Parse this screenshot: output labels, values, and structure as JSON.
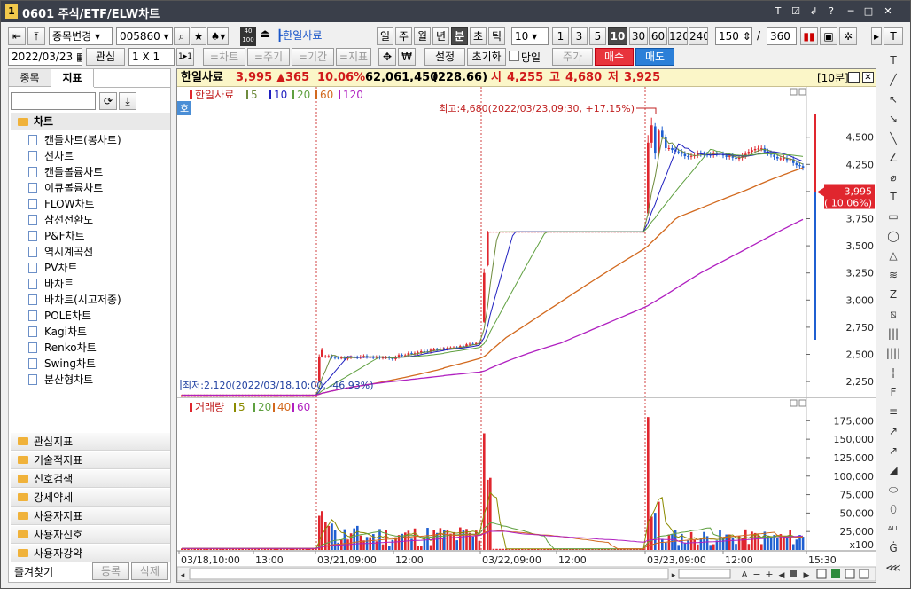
{
  "window": {
    "number": "1",
    "title": "0601 주식/ETF/ELW차트",
    "controls": [
      "T",
      "☑",
      "↲",
      "?",
      "─",
      "□",
      "✕"
    ]
  },
  "toolbar": {
    "stock_change": "종목변경",
    "stock_code": "005860",
    "stock_name": "한일사료",
    "minute_box": "40\n100",
    "periods": [
      "일",
      "주",
      "월",
      "년",
      "분",
      "초",
      "틱"
    ],
    "active_period": "분",
    "interval_value": "10",
    "intervals": [
      "1",
      "3",
      "5",
      "10",
      "30",
      "60",
      "120",
      "240"
    ],
    "active_interval": "10",
    "count_view": "150",
    "count_sep": "/",
    "count_total": "360",
    "date": "2022/03/23",
    "interest": "관심",
    "layout": "1 X 1",
    "one_by_one": "1▸1",
    "chart_btns": [
      "=차트",
      "=주기",
      "=기간",
      "=지표"
    ],
    "settings": "설정",
    "reset": "초기화",
    "sameday_label": "당일",
    "price_btn": "주가",
    "buy_btn": "매수",
    "sell_btn": "매도"
  },
  "left_panel": {
    "tabs": [
      "종목",
      "지표"
    ],
    "active_tab": "지표",
    "section_title": "차트",
    "items": [
      "캔들차트(봉차트)",
      "선차트",
      "캔들볼륨차트",
      "이큐볼륨차트",
      "FLOW차트",
      "삼선전환도",
      "P&F차트",
      "역시계곡선",
      "PV차트",
      "바차트",
      "바차트(시고저종)",
      "POLE차트",
      "Kagi차트",
      "Renko차트",
      "Swing차트",
      "분산형차트"
    ],
    "categories": [
      "관심지표",
      "기술적지표",
      "신호검색",
      "강세약세",
      "사용자지표",
      "사용자신호",
      "사용자강약"
    ],
    "favorites": "즐겨찾기",
    "register": "등록",
    "delete": "삭제"
  },
  "info_bar": {
    "name": "한일사료",
    "price": "3,995",
    "change": "▲365",
    "change_pct": "10.06%",
    "volume": "62,061,450",
    "volume_ratio": "(228.66)",
    "open_label": "시",
    "open": "4,255",
    "high_label": "고",
    "high": "4,680",
    "low_label": "저",
    "low": "3,925",
    "period_label": "[10분]"
  },
  "price_panel": {
    "legend_name": "한일사료",
    "ma_legend": [
      "5",
      "10",
      "20",
      "60",
      "120"
    ],
    "ma_colors": [
      "#6e8b3d",
      "#1f1fbf",
      "#5fa040",
      "#d2691e",
      "#b020c0"
    ],
    "hoga": "호",
    "high_annotation": "최고:4,680(2022/03/23,09:30, +17.15%)",
    "low_annotation": "최저:2,120(2022/03/18,10:00, -46.93%)",
    "current_price": "3,995",
    "current_pct": "( 10.06%)"
  },
  "volume_panel": {
    "legend_name": "거래량",
    "ma_legend": [
      "5",
      "20",
      "40",
      "60"
    ],
    "ma_colors": [
      "#8b8b00",
      "#5fa040",
      "#d2691e",
      "#b020c0"
    ],
    "unit": "x100"
  },
  "x_axis_labels": [
    "03/18,10:00",
    "13:00",
    "03/21,09:00",
    "12:00",
    "03/22,09:00",
    "12:00",
    "03/23,09:00",
    "12:00",
    "15:30"
  ],
  "chart_data": [
    {
      "type": "candlestick",
      "title": "한일사료",
      "ylim": [
        2120,
        4800
      ],
      "y_ticks": [
        "4,500",
        "4,250",
        "4,000",
        "3,750",
        "3,500",
        "3,250",
        "3,000",
        "2,750",
        "2,500",
        "2,250"
      ],
      "y_tick_values": [
        4500,
        4250,
        4000,
        3750,
        3500,
        3250,
        3000,
        2750,
        2500,
        2250
      ],
      "series": [
        {
          "name": "한일사료",
          "segments": [
            {
              "day": "03/18",
              "open": 2120,
              "close": 2130,
              "high": 2140,
              "low": 2120
            },
            {
              "day": "03/21",
              "open": 2480,
              "close": 2800,
              "high": 2810,
              "low": 2300
            },
            {
              "day": "03/22",
              "open": 2800,
              "close": 3630,
              "high": 3640,
              "low": 2790
            },
            {
              "day": "03/23",
              "open": 4255,
              "close": 3995,
              "high": 4680,
              "low": 3925
            }
          ]
        },
        {
          "name": "5",
          "line": true
        },
        {
          "name": "10",
          "line": true
        },
        {
          "name": "20",
          "line": true
        },
        {
          "name": "60",
          "line": true
        },
        {
          "name": "120",
          "line": true
        }
      ]
    },
    {
      "type": "bar",
      "title": "거래량",
      "ylim": [
        0,
        185000
      ],
      "y_ticks": [
        "175,000",
        "150,000",
        "125,000",
        "100,000",
        "75,000",
        "50,000",
        "25,000"
      ],
      "y_tick_values": [
        175000,
        150000,
        125000,
        100000,
        75000,
        50000,
        25000
      ]
    }
  ]
}
